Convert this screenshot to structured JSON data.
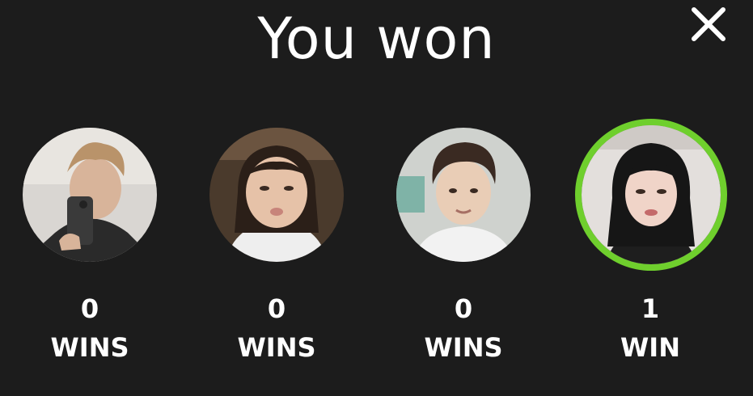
{
  "title": "You won",
  "close_icon": "close-icon",
  "players": [
    {
      "wins_count": "0",
      "wins_label": "WINS",
      "winner": false,
      "avatar": "player-avatar-photo"
    },
    {
      "wins_count": "0",
      "wins_label": "WINS",
      "winner": false,
      "avatar": "player-avatar-photo"
    },
    {
      "wins_count": "0",
      "wins_label": "WINS",
      "winner": false,
      "avatar": "player-avatar-photo"
    },
    {
      "wins_count": "1",
      "wins_label": "WIN",
      "winner": true,
      "avatar": "player-avatar-photo"
    }
  ],
  "colors": {
    "background": "#1c1c1c",
    "text": "#ffffff",
    "winner_ring": "#6fcf2d"
  }
}
